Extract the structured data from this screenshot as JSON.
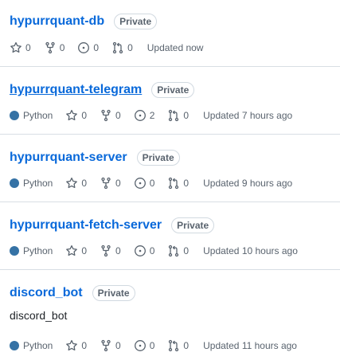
{
  "repos": [
    {
      "name": "hypurrquant-db",
      "visibility": "Private",
      "description": "",
      "language": "",
      "language_color": "#3572A5",
      "stars": "0",
      "forks": "0",
      "issues": "0",
      "pulls": "0",
      "updated": "Updated now",
      "underlined": false
    },
    {
      "name": "hypurrquant-telegram",
      "visibility": "Private",
      "description": "",
      "language": "Python",
      "language_color": "#3572A5",
      "stars": "0",
      "forks": "0",
      "issues": "2",
      "pulls": "0",
      "updated": "Updated 7 hours ago",
      "underlined": true
    },
    {
      "name": "hypurrquant-server",
      "visibility": "Private",
      "description": "",
      "language": "Python",
      "language_color": "#3572A5",
      "stars": "0",
      "forks": "0",
      "issues": "0",
      "pulls": "0",
      "updated": "Updated 9 hours ago",
      "underlined": false
    },
    {
      "name": "hypurrquant-fetch-server",
      "visibility": "Private",
      "description": "",
      "language": "Python",
      "language_color": "#3572A5",
      "stars": "0",
      "forks": "0",
      "issues": "0",
      "pulls": "0",
      "updated": "Updated 10 hours ago",
      "underlined": false
    },
    {
      "name": "discord_bot",
      "visibility": "Private",
      "description": "discord_bot",
      "language": "Python",
      "language_color": "#3572A5",
      "stars": "0",
      "forks": "0",
      "issues": "0",
      "pulls": "0",
      "updated": "Updated 11 hours ago",
      "underlined": false
    }
  ],
  "icons": {
    "star": "star-icon",
    "fork": "repo-forked-icon",
    "issue": "issue-opened-icon",
    "pull": "git-pull-request-icon"
  }
}
